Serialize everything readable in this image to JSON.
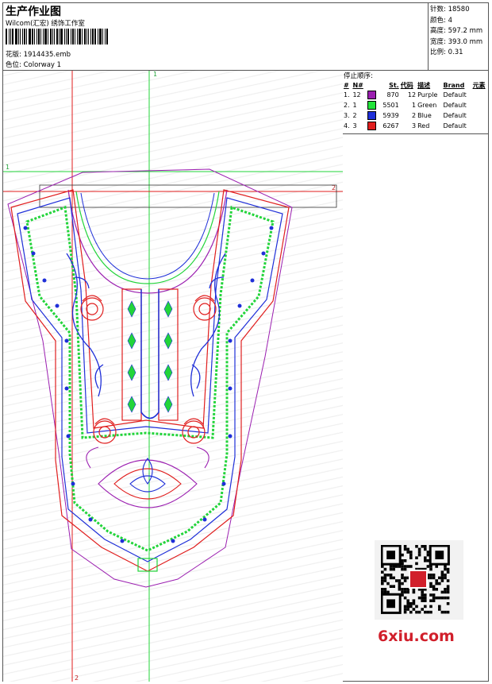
{
  "header": {
    "title": "生产作业图",
    "company": "Wilcom(汇宏) 绣饰工作室",
    "design_label": "花版:",
    "design_file": "1914435.emb",
    "colorway_label": "色位:",
    "colorway": "Colorway 1"
  },
  "stats": [
    {
      "label": "针数:",
      "value": "18580"
    },
    {
      "label": "颜色:",
      "value": "4"
    },
    {
      "label": "高度:",
      "value": "597.2 mm"
    },
    {
      "label": "宽度:",
      "value": "393.0 mm"
    },
    {
      "label": "比例:",
      "value": "0.31"
    }
  ],
  "color_table": {
    "heading": "停止顺序:",
    "columns": [
      "#",
      "N#",
      "St.",
      "代码",
      "描述",
      "Brand",
      "元素"
    ],
    "rows": [
      {
        "seq": "1.",
        "n": "12",
        "color": "#9b1fb0",
        "stitches": "870",
        "code": "12",
        "desc": "Purple",
        "brand": "Default"
      },
      {
        "seq": "2.",
        "n": "1",
        "color": "#22e33a",
        "stitches": "5501",
        "code": "1",
        "desc": "Green",
        "brand": "Default"
      },
      {
        "seq": "3.",
        "n": "2",
        "color": "#1f2fd8",
        "stitches": "5939",
        "code": "2",
        "desc": "Blue",
        "brand": "Default"
      },
      {
        "seq": "4.",
        "n": "3",
        "color": "#e01e1e",
        "stitches": "6267",
        "code": "3",
        "desc": "Red",
        "brand": "Default"
      }
    ]
  },
  "guides": {
    "v1": "1",
    "h1": "1",
    "h2": "2",
    "v2": "2"
  },
  "logo": "6xiu.com"
}
